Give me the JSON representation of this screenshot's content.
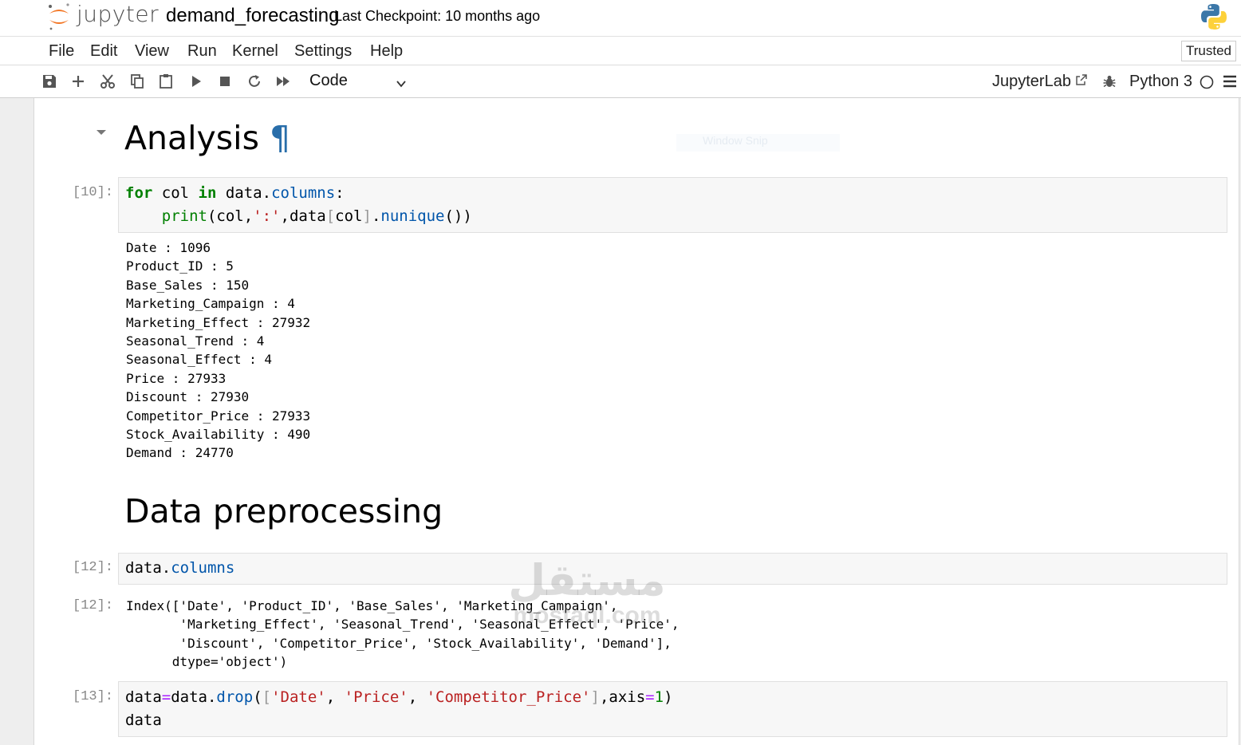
{
  "header": {
    "logo_text": "jupyter",
    "notebook_name": "demand_forecasting",
    "checkpoint": "Last Checkpoint: 10 months ago"
  },
  "menubar": {
    "items": [
      "File",
      "Edit",
      "View",
      "Run",
      "Kernel",
      "Settings",
      "Help"
    ],
    "trusted": "Trusted"
  },
  "toolbar": {
    "icons": [
      "save-icon",
      "add-icon",
      "cut-icon",
      "copy-icon",
      "paste-icon",
      "run-icon",
      "stop-icon",
      "restart-icon",
      "fast-forward-icon"
    ],
    "cell_type": "Code",
    "jupyterlab_label": "JupyterLab",
    "kernel_name": "Python 3"
  },
  "notebook": {
    "heading_analysis": "Analysis",
    "heading_preprocessing": "Data preprocessing",
    "pilcrow": "¶",
    "snip_text": "Window Snip",
    "cell1": {
      "prompt": "[10]:",
      "output_lines": [
        "Date : 1096",
        "Product_ID : 5",
        "Base_Sales : 150",
        "Marketing_Campaign : 4",
        "Marketing_Effect : 27932",
        "Seasonal_Trend : 4",
        "Seasonal_Effect : 4",
        "Price : 27933",
        "Discount : 27930",
        "Competitor_Price : 27933",
        "Stock_Availability : 490",
        "Demand : 24770"
      ]
    },
    "cell2": {
      "prompt": "[12]:",
      "output_prompt": "[12]:",
      "output_lines": [
        "Index(['Date', 'Product_ID', 'Base_Sales', 'Marketing_Campaign',",
        "       'Marketing_Effect', 'Seasonal_Trend', 'Seasonal_Effect', 'Price',",
        "       'Discount', 'Competitor_Price', 'Stock_Availability', 'Demand'],",
        "      dtype='object')"
      ]
    },
    "cell3": {
      "prompt": "[13]:"
    }
  },
  "watermark": {
    "arabic": "مستقل",
    "latin": "mostaql.com"
  },
  "colors": {
    "keyword": "#008000",
    "attribute": "#0055aa",
    "string": "#ba2121",
    "operator": "#aa22ff",
    "anchor": "#296eaa",
    "jupyter_orange": "#f37726"
  }
}
